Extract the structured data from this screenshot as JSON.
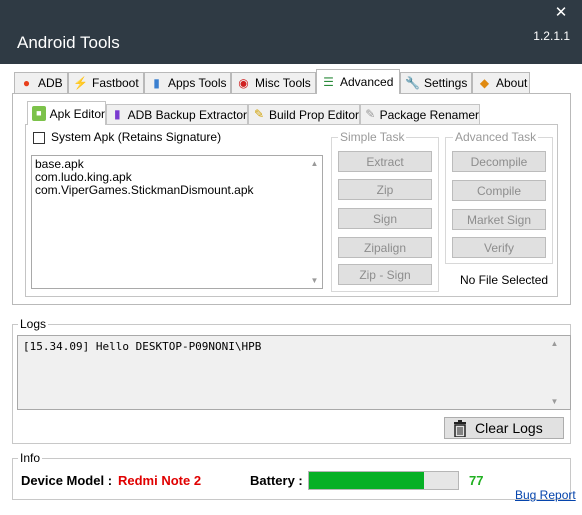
{
  "window": {
    "title": "Android Tools",
    "version": "1.2.1.1",
    "close_glyph": "✕"
  },
  "main_tabs": [
    {
      "label": "ADB",
      "icon": "fire-icon"
    },
    {
      "label": "Fastboot",
      "icon": "lightning-icon"
    },
    {
      "label": "Apps Tools",
      "icon": "bottle-icon"
    },
    {
      "label": "Misc Tools",
      "icon": "camera-icon"
    },
    {
      "label": "Advanced",
      "icon": "books-icon",
      "active": true
    },
    {
      "label": "Settings",
      "icon": "wrench-icon"
    },
    {
      "label": "About",
      "icon": "cat-icon"
    }
  ],
  "sub_tabs": [
    {
      "label": "Apk Editor",
      "icon": "android-icon",
      "active": true
    },
    {
      "label": "ADB Backup Extractor",
      "icon": "book-icon"
    },
    {
      "label": "Build Prop Editor",
      "icon": "pencil-icon"
    },
    {
      "label": "Package Renamer",
      "icon": "edit-icon"
    }
  ],
  "apk_editor": {
    "system_apk_label": "System Apk (Retains Signature)",
    "system_apk_checked": false,
    "files": [
      "base.apk",
      "com.ludo.king.apk",
      "com.ViperGames.StickmanDismount.apk"
    ],
    "simple_task": {
      "title": "Simple Task",
      "buttons": [
        "Extract",
        "Zip",
        "Sign",
        "Zipalign",
        "Zip - Sign"
      ]
    },
    "advanced_task": {
      "title": "Advanced Task",
      "buttons": [
        "Decompile",
        "Compile",
        "Market Sign",
        "Verify"
      ]
    },
    "no_file_text": "No File Selected"
  },
  "logs": {
    "title": "Logs",
    "entries": [
      "[15.34.09] Hello DESKTOP-P09NONI\\HPB"
    ],
    "clear_label": "Clear Logs"
  },
  "info": {
    "title": "Info",
    "device_model_label": "Device Model :",
    "device_model_value": "Redmi Note 2",
    "battery_label": "Battery :",
    "battery_value": "77",
    "battery_level_percent": 77,
    "link_bug_report": "Bug Report"
  },
  "colors": {
    "titlebar": "#2f3a44",
    "battery_fill": "#06b025",
    "device_model": "#e00000"
  }
}
